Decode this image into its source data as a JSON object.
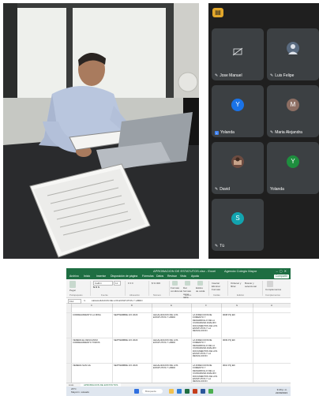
{
  "call": {
    "participants": [
      {
        "name": "Jose Manuel",
        "kind": "camera-off",
        "color": "#3c4043"
      },
      {
        "name": "Luis Felipe",
        "kind": "photo",
        "color": "#5a6b80"
      },
      {
        "name": "Yolanda",
        "kind": "initial",
        "initial": "Y",
        "color": "#1a73e8"
      },
      {
        "name": "Maria Alejandra",
        "kind": "initial",
        "initial": "M",
        "color": "#8d6e63"
      },
      {
        "name": "David",
        "kind": "photo",
        "color": "#6d4c41"
      },
      {
        "name": "Yolanda",
        "kind": "initial",
        "initial": "Y",
        "color": "#1e8e3e"
      },
      {
        "name": "Tú",
        "kind": "initial",
        "initial": "S",
        "color": "#12a4af"
      }
    ]
  },
  "excel": {
    "title": "APROBACION DE ESTATUTOS.xlsx - Excel",
    "user": "Agencia Colegio Mayor",
    "share_label": "Compartir",
    "tabs": [
      "Archivo",
      "Inicio",
      "Insertar",
      "Disposición de página",
      "Fórmulas",
      "Datos",
      "Revisar",
      "Vista",
      "Ayuda"
    ],
    "name_box": "F14",
    "formula_value": "LEGALIZACION DE LOS ESTATUTOS Y LIBRO",
    "sheet_tab": "APROBACION DE ESTATUTOS",
    "ribbon_groups": [
      "Portapapeles",
      "Fuente",
      "Alineación",
      "Número",
      "Estilos",
      "Celdas",
      "Edición",
      "Complementos"
    ],
    "ribbon_buttons": [
      "Pegar",
      "Formato condicional",
      "Dar formato como tabla",
      "Estilos de celda",
      "Insertar",
      "Eliminar",
      "Formato",
      "Ordenar y filtrar",
      "Buscar y seleccionar",
      "Complementos"
    ],
    "font_name": "Calibri",
    "font_size": "11",
    "rows": [
      {
        "name": "CORREGIMIENTO LA MINA",
        "date": "SEPTIEMBRE 2/O 2023",
        "doc": "LEGALIZACION DE LOS ESTATUTOS Y LIBRO",
        "desc": "LA DIRECCION DE FOMENTO Y DESARROLLO DE LA CIUDADANIA ANALIZO DOCUMENTOS DE LOS ESTATUTOS Y LA RESOLUCION",
        "code": "0008 PQ ED"
      },
      {
        "name": "VEREDA EL DESCANSO CORREGIMIENTO TOROS",
        "date": "SEPTIEMBRE 2/O 2023",
        "doc": "LEGALIZACION DE LOS ESTATUTOS Y LIBRO",
        "desc": "LA DIRECCION DE FOMENTO Y DESARROLLO DE LA CIUDADANIA ANALIZO DOCUMENTOS DE LOS ESTATUTOS Y LA RESOLUCION",
        "code": "0009 PQ ED"
      },
      {
        "name": "VEREDA SAN GIL",
        "date": "SEPTIEMBRE 2/O 2023",
        "doc": "LEGALIZACION DE LOS ESTATUTOS Y LIBRO",
        "desc": "LA DIRECCION DE FOMENTO Y DESARROLLO DE LA CIUDADANIA ANALIZO DOCUMENTOS DE LOS ESTATUTOS Y LA RESOLUCION",
        "code": "0010 PQ ED"
      }
    ],
    "status_text": "Listo"
  },
  "taskbar": {
    "weather_temp": "23°C",
    "weather_desc": "Mayorm. soleado",
    "search": "Búsqueda",
    "time": "3:20 p. m.",
    "date": "22/09/2023"
  }
}
